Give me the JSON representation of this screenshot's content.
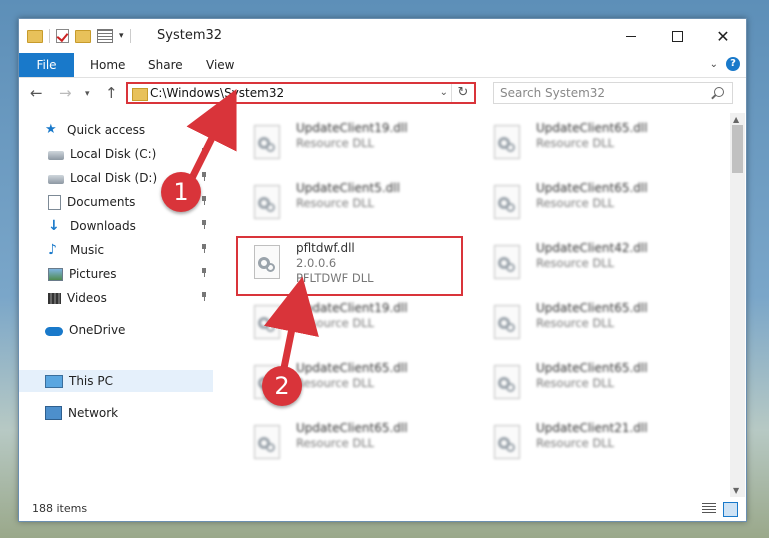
{
  "window": {
    "title": "System32",
    "minimize": "",
    "maximize": "",
    "close": "✕"
  },
  "ribbon": {
    "tabs": [
      "File",
      "Home",
      "Share",
      "View"
    ],
    "help": "?"
  },
  "address": {
    "path": "C:\\Windows\\System32",
    "refresh_icon": "↻"
  },
  "search": {
    "placeholder": "Search System32"
  },
  "sidebar": {
    "items": [
      {
        "label": "Quick access",
        "icon": "star-icon"
      },
      {
        "label": "Local Disk (C:)",
        "icon": "disk-icon"
      },
      {
        "label": "Local Disk (D:)",
        "icon": "disk-icon"
      },
      {
        "label": "Documents",
        "icon": "documents-icon"
      },
      {
        "label": "Downloads",
        "icon": "downloads-icon"
      },
      {
        "label": "Music",
        "icon": "music-icon"
      },
      {
        "label": "Pictures",
        "icon": "pictures-icon"
      },
      {
        "label": "Videos",
        "icon": "videos-icon"
      },
      {
        "label": "OneDrive",
        "icon": "cloud-icon"
      },
      {
        "label": "This PC",
        "icon": "pc-icon"
      },
      {
        "label": "Network",
        "icon": "network-icon"
      }
    ],
    "selected": "This PC"
  },
  "files": [
    {
      "name": "UpdateClient19.dll",
      "line1": "Resource DLL",
      "line2": ""
    },
    {
      "name": "UpdateClient65.dll",
      "line1": "Resource DLL",
      "line2": ""
    },
    {
      "name": "UpdateClient5.dll",
      "line1": "Resource DLL",
      "line2": ""
    },
    {
      "name": "UpdateClient65.dll",
      "line1": "Resource DLL",
      "line2": ""
    },
    {
      "name": "pfltdwf.dll",
      "line1": "2.0.0.6",
      "line2": "PFLTDWF DLL"
    },
    {
      "name": "UpdateClient42.dll",
      "line1": "Resource DLL",
      "line2": ""
    },
    {
      "name": "UpdateClient19.dll",
      "line1": "Resource DLL",
      "line2": ""
    },
    {
      "name": "UpdateClient65.dll",
      "line1": "Resource DLL",
      "line2": ""
    },
    {
      "name": "UpdateClient65.dll",
      "line1": "Resource DLL",
      "line2": ""
    },
    {
      "name": "UpdateClient65.dll",
      "line1": "Resource DLL",
      "line2": ""
    },
    {
      "name": "UpdateClient65.dll",
      "line1": "Resource DLL",
      "line2": ""
    },
    {
      "name": "UpdateClient21.dll",
      "line1": "Resource DLL",
      "line2": ""
    }
  ],
  "status": {
    "item_count": "188 items"
  },
  "annotations": {
    "step1": "1",
    "step2": "2",
    "accent_color": "#d9343a"
  },
  "colors": {
    "file_tab": "#1979ca",
    "selection": "#e5f0fb"
  }
}
